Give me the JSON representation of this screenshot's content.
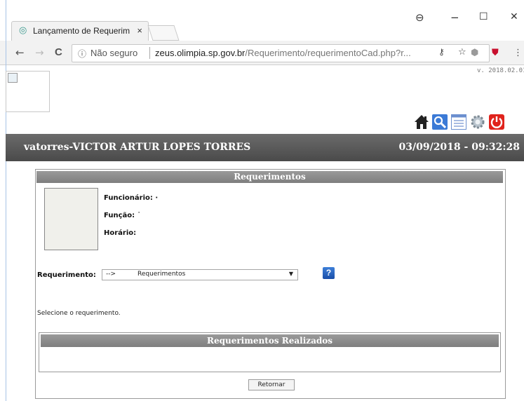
{
  "browser": {
    "tab_title": "Lançamento de Requerim",
    "tab_close": "×",
    "window_controls": {
      "profile": "⊖",
      "minimize": "−",
      "maximize": "☐",
      "close": "✕"
    },
    "nav": {
      "back": "←",
      "forward": "→",
      "reload": "C"
    },
    "security_label": "Não seguro",
    "url_host": "zeus.olimpia.sp.gov.br",
    "url_path": "/Requerimento/requerimentoCad.php?r..."
  },
  "page": {
    "version": "v. 2018.02.01",
    "toolbar_icons": [
      "home-icon",
      "search-icon",
      "list-icon",
      "settings-icon",
      "power-icon"
    ],
    "user_bar": {
      "user": "vatorres-VICTOR ARTUR LOPES TORRES",
      "datetime": "03/09/2018 - 09:32:28"
    },
    "panel": {
      "title": "Requerimentos",
      "funcionario_label": "Funcionário: ·",
      "funcao_label": "Função: ˙",
      "horario_label": "Horário:",
      "requerimento_label": "Requerimento:",
      "select_prefix": "-->",
      "select_value": "Requerimentos",
      "help_label": "?",
      "hint": "Selecione o requerimento.",
      "realizados_title": "Requerimentos Realizados",
      "back_button": "Retornar"
    }
  },
  "colors": {
    "header_gray": "#7e7e7e",
    "user_bar": "#555555",
    "help_blue": "#2a64c4",
    "power_red": "#e0231c"
  }
}
